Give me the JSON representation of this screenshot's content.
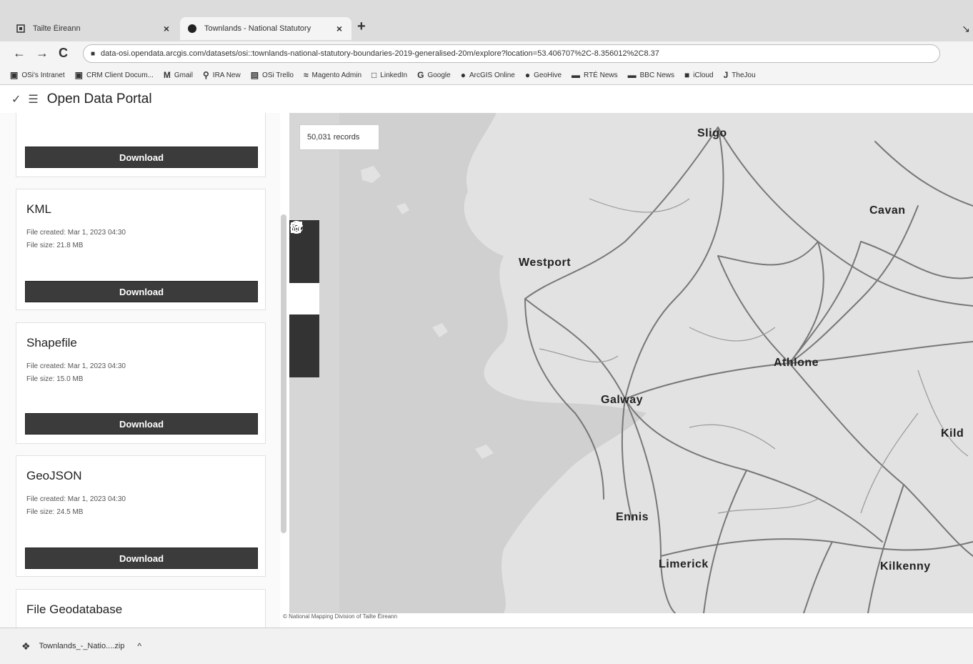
{
  "browser": {
    "tabs": [
      {
        "title": "Tailte Éireann",
        "active": false
      },
      {
        "title": "Townlands - National Statutory",
        "active": true
      }
    ],
    "new_tab": "+",
    "close_glyph": "×",
    "url": "data-osi.opendata.arcgis.com/datasets/osi::townlands-national-statutory-boundaries-2019-generalised-20m/explore?location=53.406707%2C-8.356012%2C8.37",
    "bookmarks": [
      {
        "label": "OSi's Intranet",
        "icon": "bookmark-page-icon"
      },
      {
        "label": "CRM Client Docum...",
        "icon": "bookmark-page-icon"
      },
      {
        "label": "Gmail",
        "icon": "gmail-icon"
      },
      {
        "label": "IRA New",
        "icon": "pin-icon"
      },
      {
        "label": "OSi Trello",
        "icon": "trello-icon"
      },
      {
        "label": "Magento Admin",
        "icon": "magento-icon"
      },
      {
        "label": "LinkedIn",
        "icon": "linkedin-icon"
      },
      {
        "label": "Google",
        "icon": "google-icon"
      },
      {
        "label": "ArcGIS Online",
        "icon": "arcgis-icon"
      },
      {
        "label": "GeoHive",
        "icon": "geohive-icon"
      },
      {
        "label": "RTÉ News",
        "icon": "news-icon"
      },
      {
        "label": "BBC News",
        "icon": "bbc-icon"
      },
      {
        "label": "iCloud",
        "icon": "cloud-icon"
      },
      {
        "label": "TheJou",
        "icon": "journal-icon"
      }
    ]
  },
  "portal": {
    "title": "Open Data Portal"
  },
  "downloads": {
    "button_label": "Download",
    "items": [
      {
        "name": "KML",
        "created": "File created: Mar 1, 2023 04:30",
        "size": "File size: 21.8 MB"
      },
      {
        "name": "Shapefile",
        "created": "File created: Mar 1, 2023 04:30",
        "size": "File size: 15.0 MB"
      },
      {
        "name": "GeoJSON",
        "created": "File created: Mar 1, 2023 04:30",
        "size": "File size: 24.5 MB"
      },
      {
        "name": "File Geodatabase"
      }
    ]
  },
  "map": {
    "records": "50,031 records",
    "places": [
      "Sligo",
      "Cavan",
      "Westport",
      "Athlone",
      "Galway",
      "Kild",
      "Ennis",
      "Limerick",
      "Kilkenny"
    ],
    "tools": [
      "info-icon",
      "filter-icon",
      "download-icon",
      "star-icon",
      "share-icon"
    ],
    "attribution": "© National Mapping Division of Tailte Éireann"
  },
  "shelf": {
    "file": "Townlands_-_Natio....zip",
    "chevron": "^"
  },
  "colors": {
    "download_button": "#3b3b3b",
    "map_land": "#e2e2e2",
    "map_sea": "#cfcfcf",
    "roads": "#777777",
    "tool_bar": "#333333"
  }
}
